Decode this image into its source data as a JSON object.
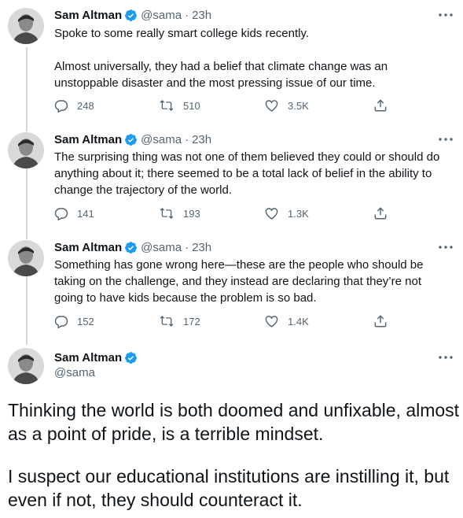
{
  "author": {
    "name": "Sam Altman",
    "handle": "@sama",
    "verified": true
  },
  "tweets": [
    {
      "time": "23h",
      "text": "Spoke to some really smart college kids recently.\n\nAlmost universally, they had a belief that climate change was an unstoppable disaster and the most pressing issue of our time.",
      "replies": "248",
      "retweets": "510",
      "likes": "3.5K"
    },
    {
      "time": "23h",
      "text": "The surprising thing was not one of them believed they could or should do anything about it; there seemed to be a total lack of belief in the ability to change the trajectory of the world.",
      "replies": "141",
      "retweets": "193",
      "likes": "1.3K"
    },
    {
      "time": "23h",
      "text": "Something has gone wrong here—these are the people who should be taking on the challenge, and they instead are declaring that they’re not going to have kids because the problem is so bad.",
      "replies": "152",
      "retweets": "172",
      "likes": "1.4K"
    }
  ],
  "main_tweet": {
    "paragraph_1": "Thinking the world is both doomed and unfixable, almost as a point of pride, is a terrible mindset.",
    "paragraph_2": "I suspect our educational institutions are instilling it, but even if not, they should counteract it."
  },
  "icons": {
    "reply": "reply-icon",
    "retweet": "retweet-icon",
    "like": "heart-icon",
    "share": "share-icon",
    "more": "more-icon",
    "verified": "verified-badge-icon"
  },
  "colors": {
    "verified_blue": "#1d9bf0",
    "text_primary": "#0f1419",
    "text_secondary": "#536471",
    "thread_line": "#cfd9de"
  }
}
